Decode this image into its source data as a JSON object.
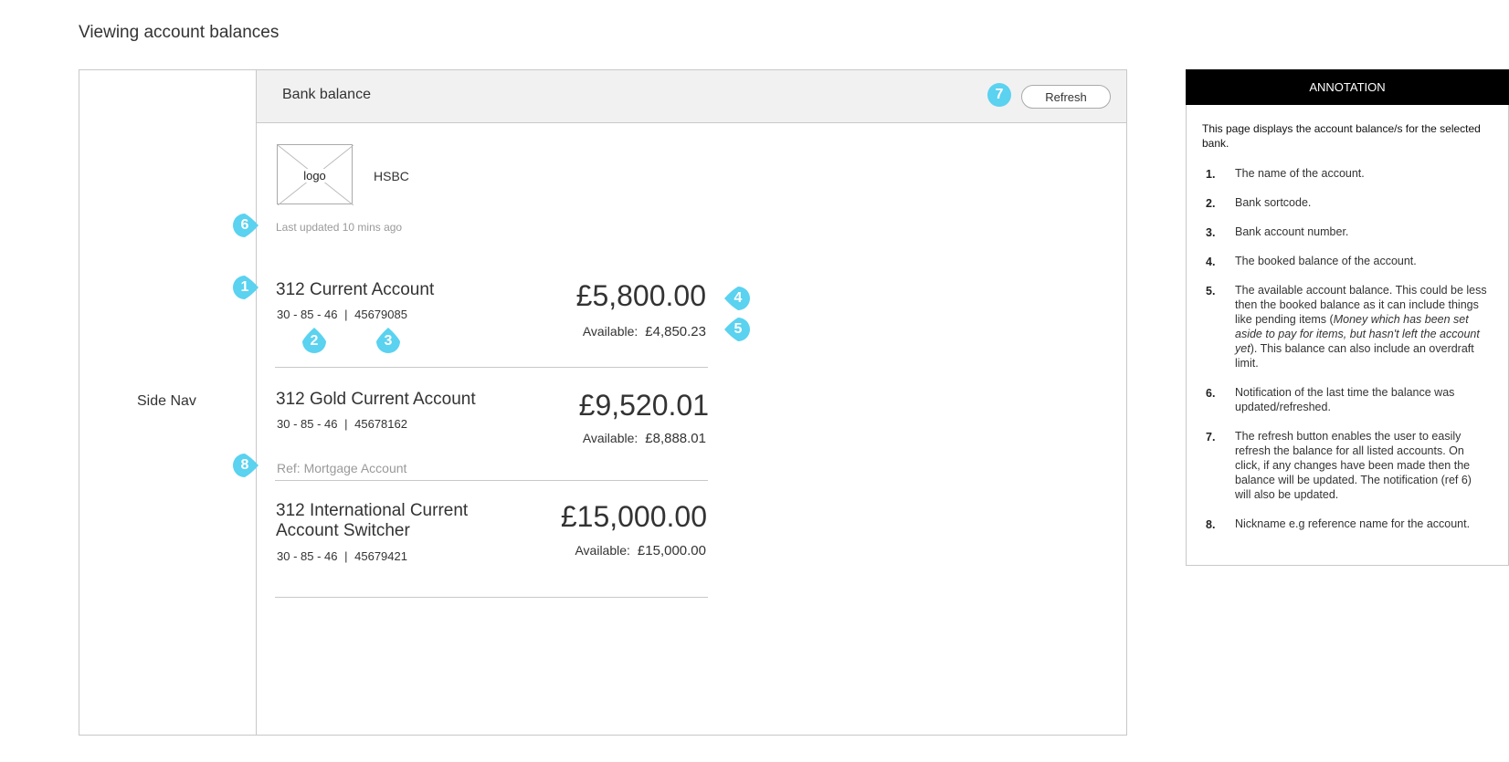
{
  "page": {
    "title": "Viewing account balances"
  },
  "side_nav": {
    "label": "Side Nav"
  },
  "header": {
    "title": "Bank balance",
    "refresh_label": "Refresh"
  },
  "bank": {
    "logo_label": "logo",
    "name": "HSBC",
    "last_updated": "Last updated 10 mins ago"
  },
  "accounts": [
    {
      "name": "312 Current Account",
      "sortcode": "30 - 85 - 46",
      "separator": "|",
      "number": "45679085",
      "balance": "£5,800.00",
      "available_label": "Available:",
      "available": "£4,850.23"
    },
    {
      "name": "312 Gold Current Account",
      "sortcode": "30 - 85 - 46",
      "separator": "|",
      "number": "45678162",
      "balance": "£9,520.01",
      "available_label": "Available:",
      "available": "£8,888.01",
      "ref": "Ref: Mortgage Account"
    },
    {
      "name": "312 International Current Account Switcher",
      "sortcode": "30 - 85 - 46",
      "separator": "|",
      "number": "45679421",
      "balance": "£15,000.00",
      "available_label": "Available:",
      "available": "£15,000.00"
    }
  ],
  "markers": [
    "1",
    "2",
    "3",
    "4",
    "5",
    "6",
    "7",
    "8"
  ],
  "marker_color": "#5ad2f0",
  "annotation": {
    "heading": "ANNOTATION",
    "intro": "This page displays the account balance/s for the selected bank.",
    "items": [
      {
        "num": "1.",
        "text": "The name of the account."
      },
      {
        "num": "2.",
        "text": "Bank sortcode."
      },
      {
        "num": "3.",
        "text": "Bank account number."
      },
      {
        "num": "4.",
        "text": "The booked balance of the account."
      },
      {
        "num": "5.",
        "text_a": "The available account balance. This could be less then the booked balance as it can include things like pending items (",
        "text_italic": "Money which has been set aside to pay for items, but hasn't left the account yet",
        "text_b": "). This balance can also include an overdraft limit."
      },
      {
        "num": "6.",
        "text": "Notification of the last time the balance was updated/refreshed."
      },
      {
        "num": "7.",
        "text": "The refresh button enables the user to easily refresh the balance for all listed accounts. On click, if any changes have been made then the balance will be updated. The notification (ref 6) will also be updated."
      },
      {
        "num": "8.",
        "text": "Nickname e.g reference name for the account."
      }
    ]
  }
}
